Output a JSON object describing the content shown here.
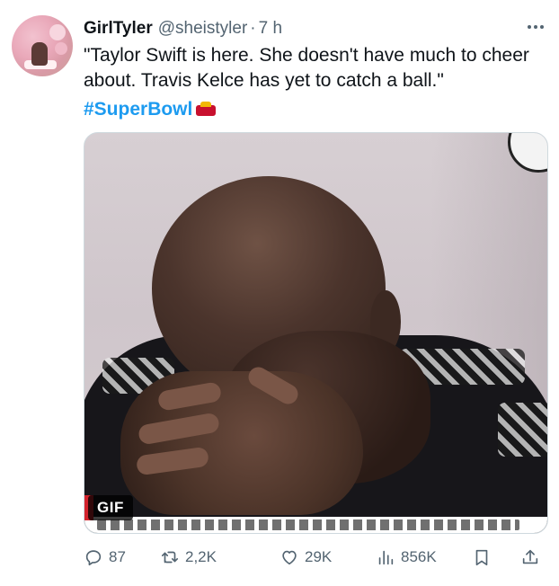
{
  "user": {
    "name": "GirlTyler",
    "handle": "@sheistyler",
    "separator": "·",
    "time": "7 h"
  },
  "tweet": {
    "text": "\"Taylor Swift is here. She doesn't have much to cheer about. Travis Kelce has yet to catch a ball.\"",
    "hashtag": "#SuperBowl"
  },
  "media": {
    "badge": "GIF"
  },
  "icons": {
    "more": "more-icon",
    "reply": "reply-icon",
    "retweet": "retweet-icon",
    "like": "heart-icon",
    "views": "views-icon",
    "bookmark": "bookmark-icon",
    "share": "share-icon",
    "superbowl": "superbowl-logo-icon"
  },
  "stats": {
    "replies": "87",
    "retweets": "2,2K",
    "likes": "29K",
    "views": "856K"
  },
  "colors": {
    "accent": "#1d9bf0",
    "muted": "#536471",
    "text": "#0f1419",
    "border": "#cfd9de"
  }
}
